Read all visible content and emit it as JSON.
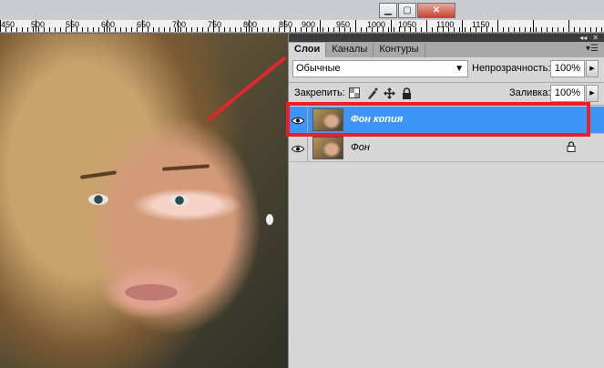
{
  "ruler": {
    "labels": [
      "450",
      "500",
      "550",
      "600",
      "650",
      "700",
      "750",
      "800",
      "850",
      "900",
      "950",
      "1000",
      "1050",
      "1100",
      "1150"
    ]
  },
  "window_controls": {
    "minimize": "minimize-icon",
    "restore": "restore-icon",
    "close": "close-icon"
  },
  "panel": {
    "tabs": [
      {
        "label": "Слои",
        "active": true
      },
      {
        "label": "Каналы",
        "active": false
      },
      {
        "label": "Контуры",
        "active": false
      }
    ],
    "blend_mode": "Обычные",
    "opacity_label": "Непрозрачность:",
    "opacity_value": "100%",
    "lock_label": "Закрепить:",
    "fill_label": "Заливка:",
    "fill_value": "100%",
    "layers": [
      {
        "name": "Фон копия",
        "selected": true,
        "visible": true,
        "locked": false
      },
      {
        "name": "Фон",
        "selected": false,
        "visible": true,
        "locked": true
      }
    ]
  },
  "colors": {
    "selection": "#3d96f5",
    "annotation": "#e8202c",
    "panel_bg": "#d6d6d6"
  }
}
